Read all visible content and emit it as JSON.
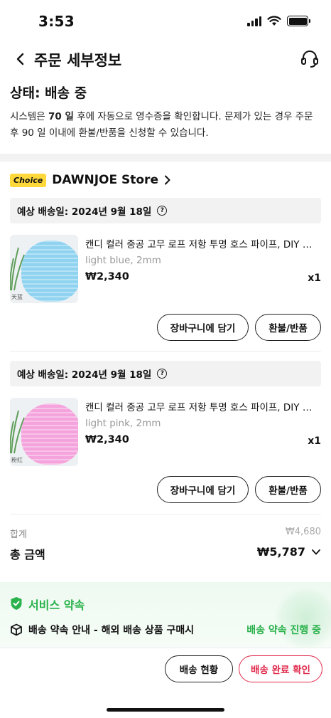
{
  "status_bar": {
    "time": "3:53"
  },
  "nav": {
    "title": "주문 세부정보"
  },
  "order_status": {
    "title": "상태: 배송 중",
    "desc_prefix": "시스템은 ",
    "desc_days": "70 일",
    "desc_suffix": " 후에 자동으로 영수증을 확인합니다. 문제가 있는 경우 주문 후 90 일 이내에 환불/반품을 신청할 수 있습니다."
  },
  "store": {
    "badge": "Choice",
    "name": "DAWNJOE Store"
  },
  "items": [
    {
      "delivery": "예상 배송일: 2024년 9월 18일",
      "title": "캔디 컬러 중공 고무 로프 저항 투명 호스 파이프, DIY 쥬얼리",
      "variant": "light blue, 2mm",
      "price": "₩2,340",
      "qty": "x1",
      "color": "#8fd3f0",
      "thumb_tag": "天蓝"
    },
    {
      "delivery": "예상 배송일: 2024년 9월 18일",
      "title": "캔디 컬러 중공 고무 로프 저항 투명 호스 파이프, DIY 쥬얼리",
      "variant": "light pink, 2mm",
      "price": "₩2,340",
      "qty": "x1",
      "color": "#f5a3dc",
      "thumb_tag": "粉红"
    }
  ],
  "buttons": {
    "cart": "장바구니에 담기",
    "refund": "환불/반품"
  },
  "totals": {
    "sum_label": "합계",
    "sum_value": "₩4,680",
    "total_label": "총 금액",
    "total_value": "₩5,787"
  },
  "service": {
    "title": "서비스 약속",
    "desc": "배송 약속 안내 - 해외 배송 상품 구매시",
    "status": "배송 약속 진행 중"
  },
  "bottom": {
    "track": "배송 현황",
    "confirm": "배송 완료 확인"
  },
  "colors": {
    "accent_green": "#2bb24c",
    "accent_red": "#e0284a",
    "choice_yellow": "#ffd93b"
  }
}
